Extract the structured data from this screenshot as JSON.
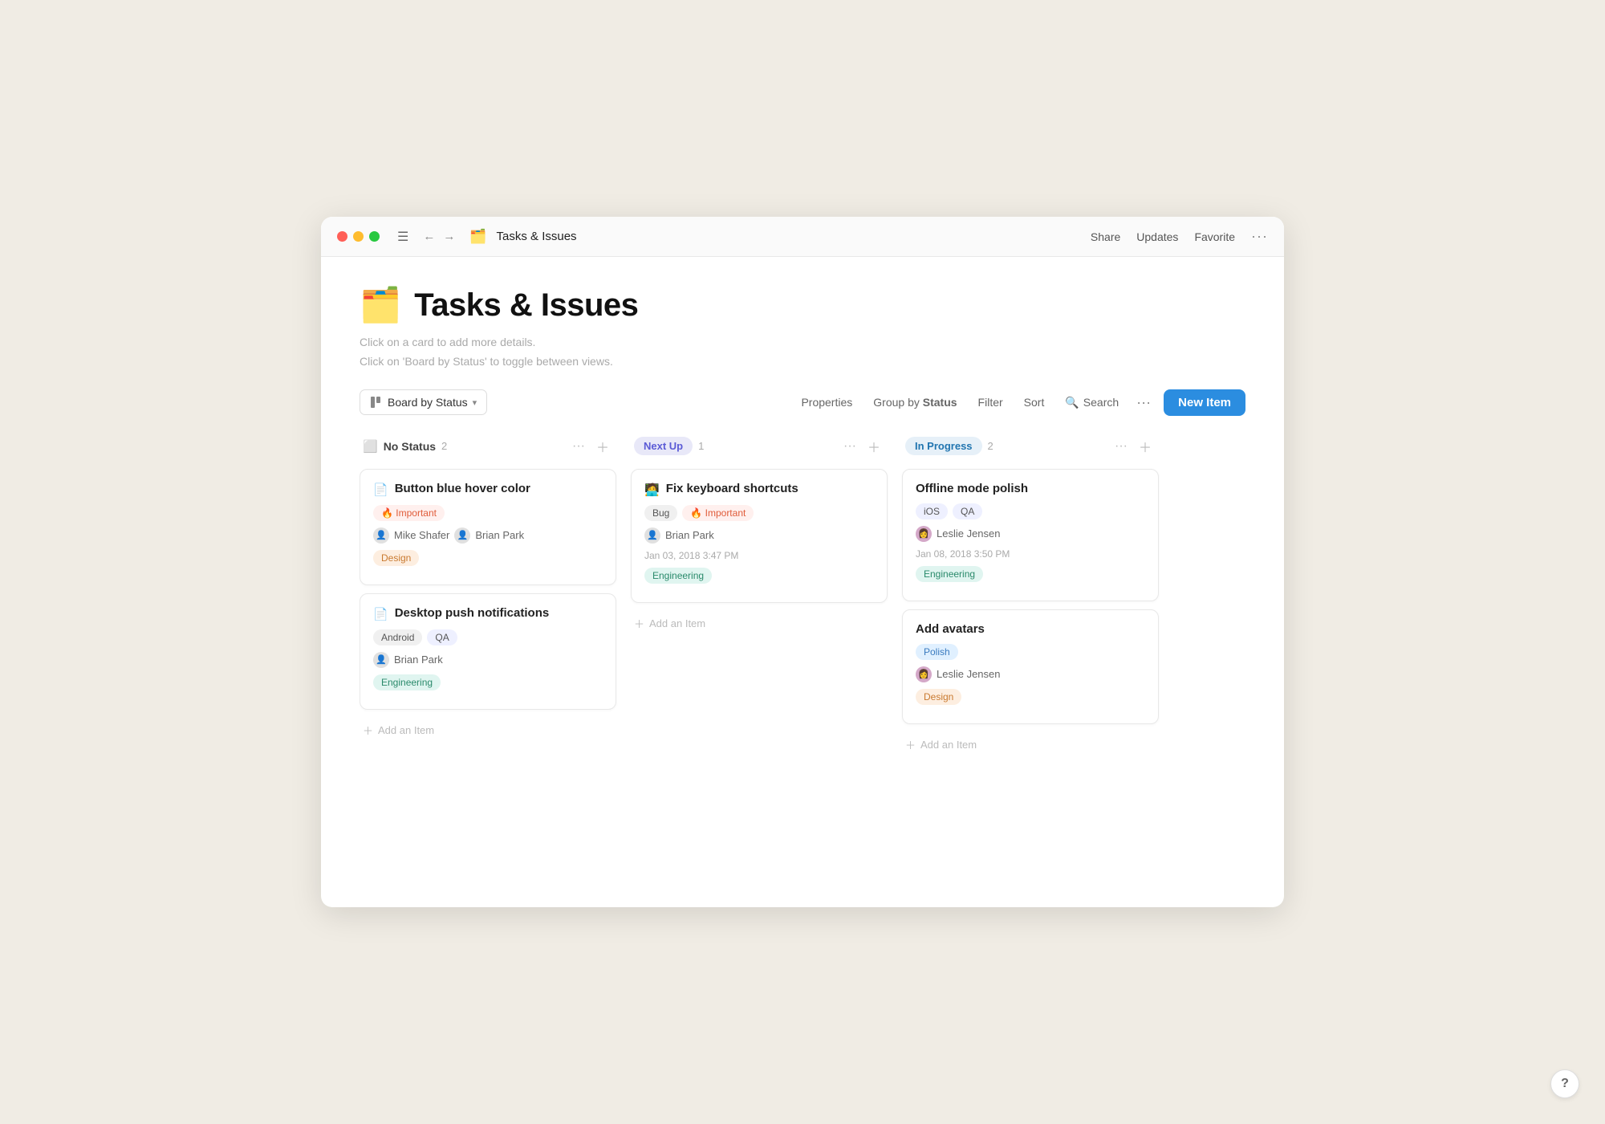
{
  "titlebar": {
    "title": "Tasks & Issues",
    "app_icon": "🗂️",
    "actions": [
      "Share",
      "Updates",
      "Favorite",
      "···"
    ]
  },
  "page": {
    "icon": "🗂️",
    "title": "Tasks & Issues",
    "desc1": "Click on a card to add more details.",
    "desc2": "Click on 'Board by Status' to toggle between views."
  },
  "toolbar": {
    "view_label": "Board by Status",
    "properties": "Properties",
    "group_by": "Group by",
    "group_by_bold": "Status",
    "filter": "Filter",
    "sort": "Sort",
    "search": "Search",
    "more": "···",
    "new_item": "New Item"
  },
  "columns": [
    {
      "id": "no-status",
      "label": "No Status",
      "badge_class": "badge-nostatus",
      "count": 2,
      "cards": [
        {
          "id": "card-1",
          "title": "Button blue hover color",
          "icon": "📄",
          "tags": [
            {
              "label": "🔥 Important",
              "class": "tag-important"
            }
          ],
          "people": [
            {
              "name": "Mike Shafer",
              "icon": "👤"
            },
            {
              "name": "Brian Park",
              "icon": "👤"
            }
          ],
          "date": null,
          "bottom_tags": [
            {
              "label": "Design",
              "class": "tag-design"
            }
          ]
        },
        {
          "id": "card-2",
          "title": "Desktop push notifications",
          "icon": "📄",
          "tags": [
            {
              "label": "Android",
              "class": "tag-android"
            },
            {
              "label": "QA",
              "class": "tag-qa"
            }
          ],
          "people": [
            {
              "name": "Brian Park",
              "icon": "👤"
            }
          ],
          "date": null,
          "bottom_tags": [
            {
              "label": "Engineering",
              "class": "tag-engineering"
            }
          ]
        }
      ],
      "add_label": "Add an Item"
    },
    {
      "id": "next-up",
      "label": "Next Up",
      "badge_class": "badge-nextup",
      "count": 1,
      "cards": [
        {
          "id": "card-3",
          "title": "Fix keyboard shortcuts",
          "icon": "🧑‍💻",
          "tags": [
            {
              "label": "Bug",
              "class": "tag-bug"
            },
            {
              "label": "🔥 Important",
              "class": "tag-important"
            }
          ],
          "people": [
            {
              "name": "Brian Park",
              "icon": "👤"
            }
          ],
          "date": "Jan 03, 2018 3:47 PM",
          "bottom_tags": [
            {
              "label": "Engineering",
              "class": "tag-engineering"
            }
          ]
        }
      ],
      "add_label": "Add an Item"
    },
    {
      "id": "in-progress",
      "label": "In Progress",
      "badge_class": "badge-inprogress",
      "count": 2,
      "cards": [
        {
          "id": "card-4",
          "title": "Offline mode polish",
          "icon": null,
          "tags": [
            {
              "label": "iOS",
              "class": "tag-ios"
            },
            {
              "label": "QA",
              "class": "tag-qa"
            }
          ],
          "people": [
            {
              "name": "Leslie Jensen",
              "icon": "👩"
            }
          ],
          "date": "Jan 08, 2018 3:50 PM",
          "bottom_tags": [
            {
              "label": "Engineering",
              "class": "tag-engineering"
            }
          ]
        },
        {
          "id": "card-5",
          "title": "Add avatars",
          "icon": null,
          "tags": [],
          "people": [
            {
              "name": "Leslie Jensen",
              "icon": "👩"
            }
          ],
          "date": null,
          "bottom_tags": [
            {
              "label": "Polish",
              "class": "tag-polish"
            },
            {
              "label": "Design",
              "class": "tag-design"
            }
          ],
          "bottom_tags_top": [
            {
              "label": "Polish",
              "class": "tag-polish"
            }
          ]
        }
      ],
      "add_label": "Add an Item"
    }
  ],
  "help": "?"
}
